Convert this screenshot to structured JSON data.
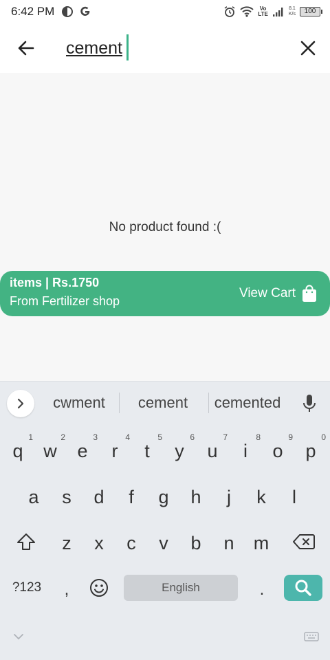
{
  "status_bar": {
    "time": "6:42 PM",
    "volte_top": "Vo",
    "volte_bottom": "LTE",
    "speed_value": "8.1",
    "speed_unit": "K/s",
    "battery": "100"
  },
  "search": {
    "query": "cement",
    "accent_color": "#3db38a"
  },
  "content": {
    "empty_message": "No product found :("
  },
  "cart": {
    "items_text": "items | Rs.1750",
    "shop_text": "From Fertilizer shop",
    "view_cart_label": "View Cart",
    "color": "#43b383"
  },
  "keyboard": {
    "suggestions": [
      "cwment",
      "cement",
      "cemented"
    ],
    "row1": [
      {
        "key": "q",
        "hint": "1"
      },
      {
        "key": "w",
        "hint": "2"
      },
      {
        "key": "e",
        "hint": "3"
      },
      {
        "key": "r",
        "hint": "4"
      },
      {
        "key": "t",
        "hint": "5"
      },
      {
        "key": "y",
        "hint": "6"
      },
      {
        "key": "u",
        "hint": "7"
      },
      {
        "key": "i",
        "hint": "8"
      },
      {
        "key": "o",
        "hint": "9"
      },
      {
        "key": "p",
        "hint": "0"
      }
    ],
    "row2": [
      "a",
      "s",
      "d",
      "f",
      "g",
      "h",
      "j",
      "k",
      "l"
    ],
    "row3": [
      "z",
      "x",
      "c",
      "v",
      "b",
      "n",
      "m"
    ],
    "symbols_label": "?123",
    "comma": ",",
    "period": ".",
    "space_label": "English",
    "search_key_color": "#4db6ac"
  }
}
